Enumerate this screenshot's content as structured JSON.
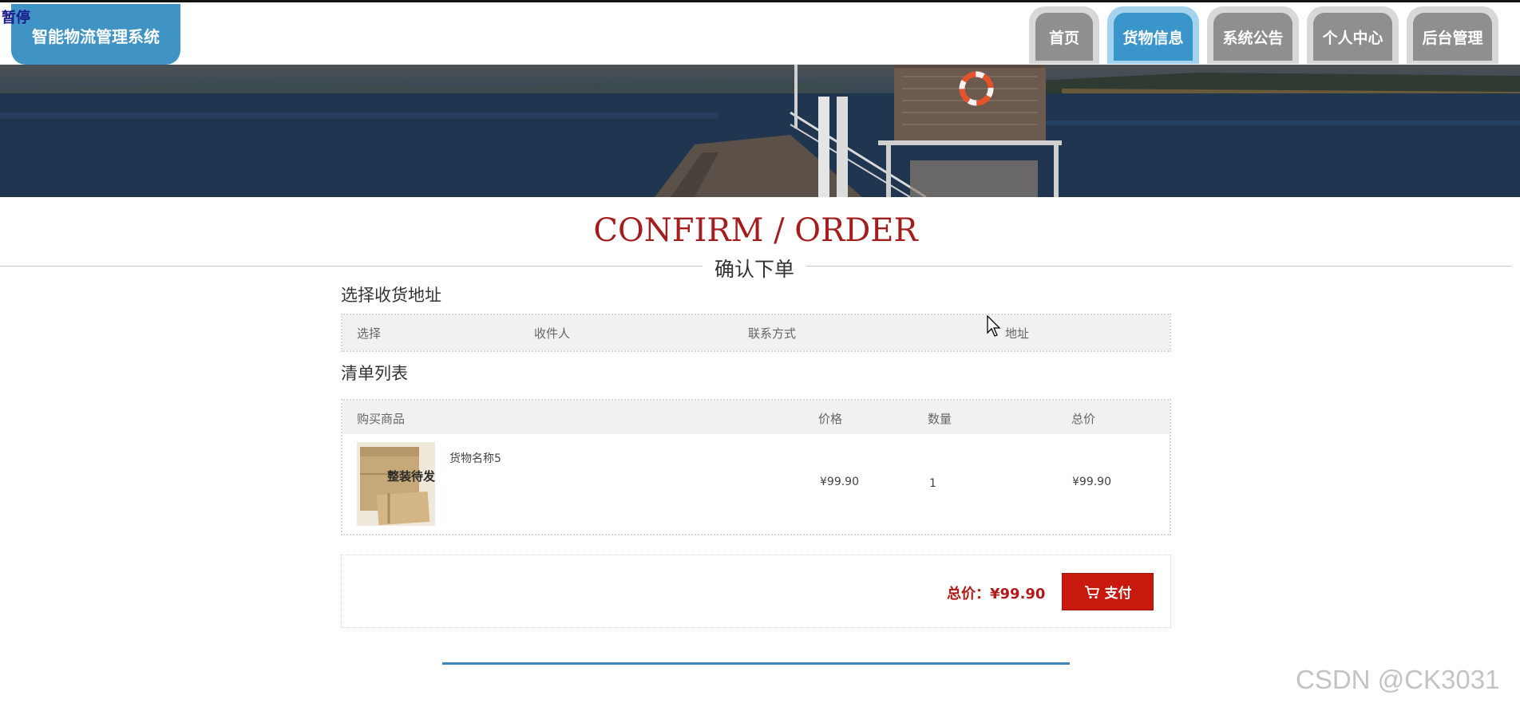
{
  "overlay": {
    "pause_label": "暂停"
  },
  "header": {
    "logo_text": "智能物流管理系统",
    "nav": [
      {
        "label": "首页",
        "active": false
      },
      {
        "label": "货物信息",
        "active": true
      },
      {
        "label": "系统公告",
        "active": false
      },
      {
        "label": "个人中心",
        "active": false
      },
      {
        "label": "后台管理",
        "active": false
      }
    ]
  },
  "page_title": {
    "en": "CONFIRM / ORDER",
    "cn": "确认下单"
  },
  "address_section": {
    "title": "选择收货地址",
    "columns": [
      "选择",
      "收件人",
      "联系方式",
      "地址"
    ]
  },
  "list_section": {
    "title": "清单列表",
    "columns": [
      "购买商品",
      "价格",
      "数量",
      "总价"
    ],
    "rows": [
      {
        "name": "货物名称5",
        "price": "¥99.90",
        "qty": "1",
        "total": "¥99.90",
        "image_text": "整装待发"
      }
    ]
  },
  "summary": {
    "total_label": "总价：",
    "total_value": "¥99.90",
    "pay_label": "支付"
  },
  "watermark": "CSDN @CK3031",
  "colors": {
    "brand_blue": "#3f93c5",
    "title_red": "#a31d1d",
    "pay_red": "#c8190f",
    "nav_gray": "#8f8f8f"
  }
}
